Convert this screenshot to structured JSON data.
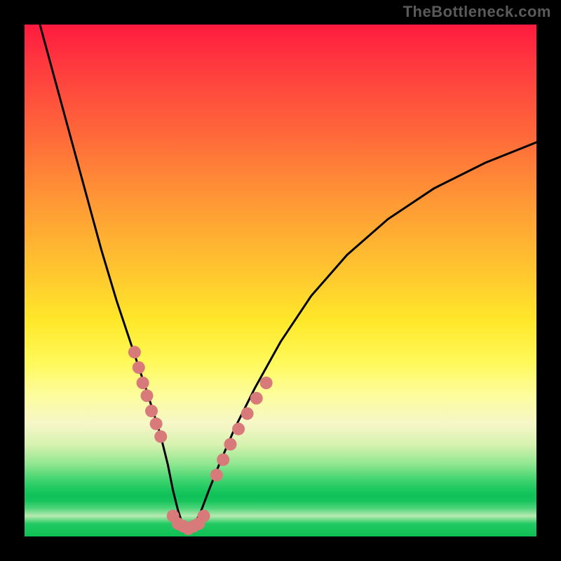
{
  "watermark": "TheBottleneck.com",
  "chart_data": {
    "type": "line",
    "title": "",
    "xlabel": "",
    "ylabel": "",
    "xlim": [
      0,
      100
    ],
    "ylim": [
      0,
      100
    ],
    "series": [
      {
        "name": "bottleneck-curve",
        "x": [
          3,
          6,
          9,
          12,
          15,
          18,
          21,
          24,
          26.5,
          28,
          29,
          30,
          31,
          32,
          33,
          34.5,
          36,
          38,
          41,
          45,
          50,
          56,
          63,
          71,
          80,
          90,
          100
        ],
        "y": [
          100,
          89,
          78,
          67,
          56,
          46,
          37,
          28,
          20,
          14,
          9,
          5,
          2,
          1,
          2,
          5,
          9,
          14,
          21,
          29,
          38,
          47,
          55,
          62,
          68,
          73,
          77
        ]
      }
    ],
    "markers": {
      "name": "highlight-dots",
      "color": "#d87a7a",
      "radius_px": 9,
      "points_xy": [
        [
          21.5,
          36
        ],
        [
          22.3,
          33
        ],
        [
          23.1,
          30
        ],
        [
          23.9,
          27.5
        ],
        [
          24.8,
          24.5
        ],
        [
          25.7,
          22
        ],
        [
          26.6,
          19.5
        ],
        [
          29.0,
          4
        ],
        [
          30.0,
          2.5
        ],
        [
          31.0,
          2
        ],
        [
          32.0,
          1.5
        ],
        [
          33.0,
          2
        ],
        [
          34.0,
          2.5
        ],
        [
          35.0,
          4
        ],
        [
          37.5,
          12
        ],
        [
          38.8,
          15
        ],
        [
          40.2,
          18
        ],
        [
          41.8,
          21
        ],
        [
          43.5,
          24
        ],
        [
          45.3,
          27
        ],
        [
          47.2,
          30
        ]
      ]
    }
  }
}
